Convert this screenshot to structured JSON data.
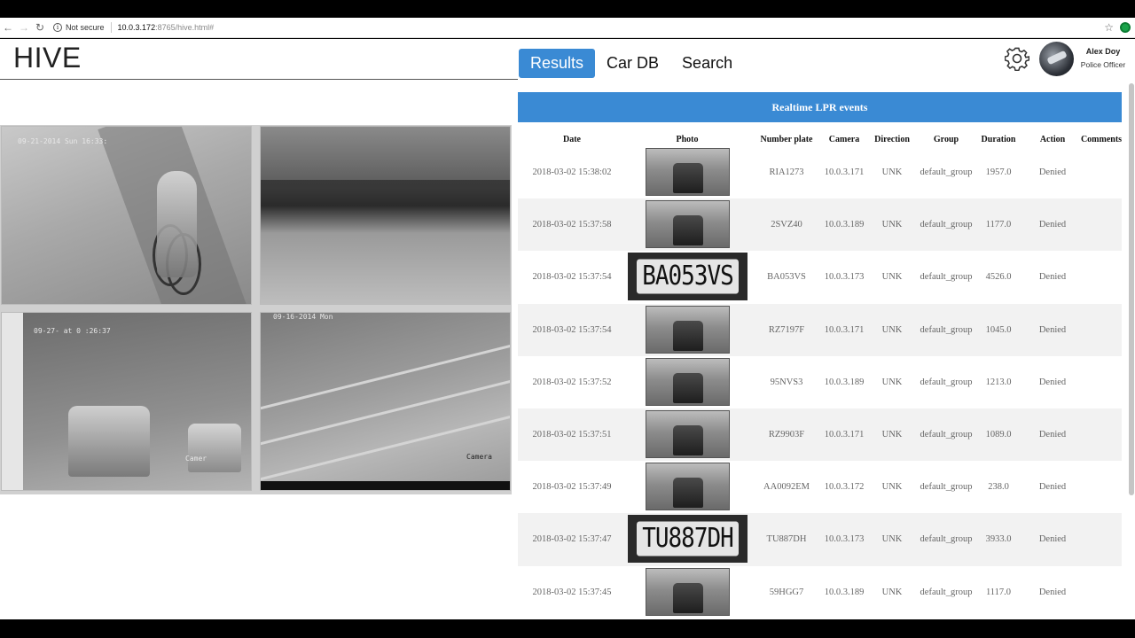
{
  "browser": {
    "security_text": "Not secure",
    "url_host": "10.0.3.172",
    "url_rest": ":8765/hive.html#"
  },
  "app": {
    "logo": "HIVE",
    "tabs": [
      {
        "label": "Results",
        "active": true
      },
      {
        "label": "Car DB",
        "active": false
      },
      {
        "label": "Search",
        "active": false
      }
    ],
    "user": {
      "name": "Alex Doy",
      "role": "Police Officer"
    }
  },
  "cameras": [
    {
      "stamp": "09-21-2014 Sun 16:33:"
    },
    {
      "stamp": ""
    },
    {
      "stamp": "09-27-       at 0 :26:37",
      "label": "Camer"
    },
    {
      "stamp": "09-16-2014 Mon",
      "label": "Camera"
    }
  ],
  "events": {
    "title": "Realtime LPR events",
    "columns": [
      "Date",
      "Photo",
      "Number plate",
      "Camera",
      "Direction",
      "Group",
      "Duration",
      "Action",
      "Comments"
    ],
    "rows": [
      {
        "date": "2018-03-02 15:38:02",
        "photo": "car",
        "plate": "RIA1273",
        "camera": "10.0.3.171",
        "direction": "UNK",
        "group": "default_group",
        "duration": "1957.0",
        "action": "Denied",
        "comments": ""
      },
      {
        "date": "2018-03-02 15:37:58",
        "photo": "car",
        "plate": "2SVZ40",
        "camera": "10.0.3.189",
        "direction": "UNK",
        "group": "default_group",
        "duration": "1177.0",
        "action": "Denied",
        "comments": ""
      },
      {
        "date": "2018-03-02 15:37:54",
        "photo": "plate",
        "photo_text": "BA053VS",
        "plate": "BA053VS",
        "camera": "10.0.3.173",
        "direction": "UNK",
        "group": "default_group",
        "duration": "4526.0",
        "action": "Denied",
        "comments": ""
      },
      {
        "date": "2018-03-02 15:37:54",
        "photo": "car",
        "plate": "RZ7197F",
        "camera": "10.0.3.171",
        "direction": "UNK",
        "group": "default_group",
        "duration": "1045.0",
        "action": "Denied",
        "comments": ""
      },
      {
        "date": "2018-03-02 15:37:52",
        "photo": "car",
        "plate": "95NVS3",
        "camera": "10.0.3.189",
        "direction": "UNK",
        "group": "default_group",
        "duration": "1213.0",
        "action": "Denied",
        "comments": ""
      },
      {
        "date": "2018-03-02 15:37:51",
        "photo": "car",
        "plate": "RZ9903F",
        "camera": "10.0.3.171",
        "direction": "UNK",
        "group": "default_group",
        "duration": "1089.0",
        "action": "Denied",
        "comments": ""
      },
      {
        "date": "2018-03-02 15:37:49",
        "photo": "car",
        "plate": "AA0092EM",
        "camera": "10.0.3.172",
        "direction": "UNK",
        "group": "default_group",
        "duration": "238.0",
        "action": "Denied",
        "comments": ""
      },
      {
        "date": "2018-03-02 15:37:47",
        "photo": "plate",
        "photo_text": "TU887DH",
        "plate": "TU887DH",
        "camera": "10.0.3.173",
        "direction": "UNK",
        "group": "default_group",
        "duration": "3933.0",
        "action": "Denied",
        "comments": ""
      },
      {
        "date": "2018-03-02 15:37:45",
        "photo": "car",
        "plate": "59HGG7",
        "camera": "10.0.3.189",
        "direction": "UNK",
        "group": "default_group",
        "duration": "1117.0",
        "action": "Denied",
        "comments": ""
      }
    ]
  },
  "colors": {
    "accent": "#3a8ad4",
    "row_alt": "#f2f2f2"
  },
  "icons": {
    "settings": "gear-icon",
    "back": "back-arrow-icon",
    "forward": "forward-arrow-icon",
    "reload": "reload-icon",
    "bookmark": "star-icon"
  }
}
